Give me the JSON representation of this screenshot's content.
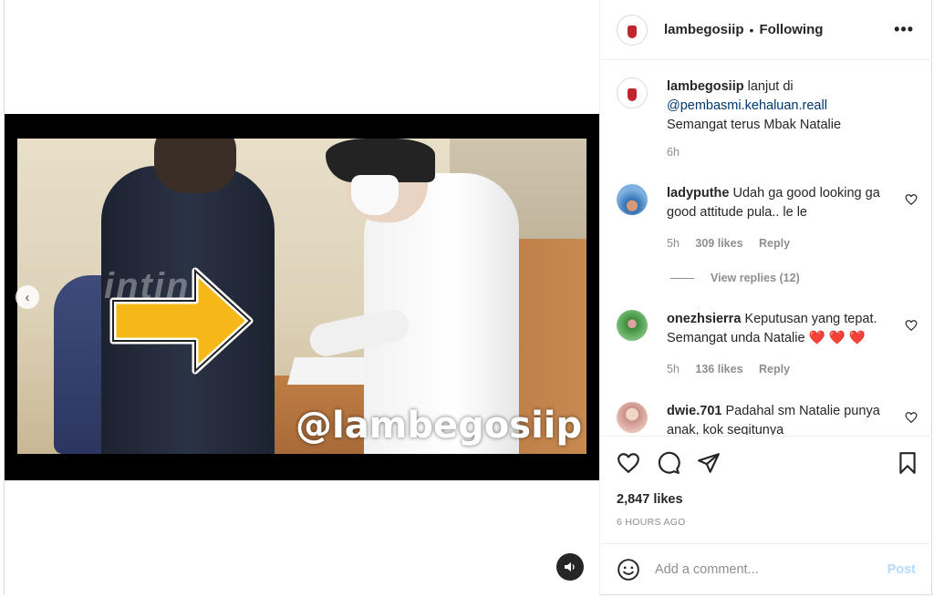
{
  "header": {
    "username": "lambegosiip",
    "separator": "•",
    "follow_status": "Following",
    "more_icon": "more-horizontal-icon"
  },
  "media": {
    "overlay_handle": "@lambegosiip",
    "watermark": "intin",
    "prev_icon": "chevron-left-icon",
    "audio_icon": "speaker-icon"
  },
  "caption": {
    "username": "lambegosiip",
    "text_before": "lanjut di",
    "mention": "@pembasmi.kehaluan.reall",
    "text_after": "Semangat terus Mbak Natalie",
    "time": "6h"
  },
  "comments": [
    {
      "username": "ladyputhe",
      "text": "Udah ga good looking ga good attitude pula.. le le",
      "time": "5h",
      "likes": "309 likes",
      "reply": "Reply",
      "view_replies": "View replies (12)"
    },
    {
      "username": "onezhsierra",
      "text": "Keputusan yang tepat. Semangat unda Natalie",
      "emoji": "❤️ ❤️ ❤️",
      "time": "5h",
      "likes": "136 likes",
      "reply": "Reply"
    },
    {
      "username": "dwie.701",
      "text": "Padahal sm Natalie punya anak, kok segitunya"
    }
  ],
  "actions": {
    "likes": "2,847 likes",
    "time_ago": "6 HOURS AGO"
  },
  "add_comment": {
    "placeholder": "Add a comment...",
    "post_label": "Post"
  },
  "colors": {
    "text": "#262626",
    "muted": "#8e8e8e",
    "link": "#00376b",
    "post_disabled": "#b3dbff",
    "heart_red": "#ed4956"
  }
}
